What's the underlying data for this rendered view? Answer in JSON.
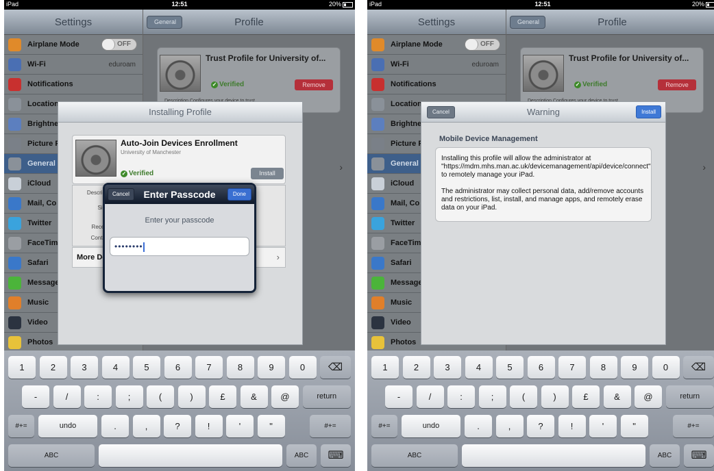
{
  "left": {
    "status": {
      "device": "iPad",
      "time": "12:51",
      "battery": "20%"
    },
    "sidebar": {
      "title": "Settings",
      "items": [
        {
          "label": "Airplane Mode",
          "icon": "airplane-icon",
          "color": "#e08a2a"
        },
        {
          "label": "Wi-Fi",
          "icon": "wifi-icon",
          "color": "#4a6fb3",
          "value": "eduroam"
        },
        {
          "label": "Notifications",
          "icon": "notifications-icon",
          "color": "#c8302f"
        },
        {
          "label": "Location",
          "icon": "location-icon",
          "color": "#8a9199"
        },
        {
          "label": "Brightne",
          "icon": "brightness-icon",
          "color": "#5c7fbf"
        },
        {
          "label": "Picture F",
          "icon": "picture-frame-icon",
          "color": "#7a8088"
        },
        {
          "label": "General",
          "icon": "gear-icon",
          "color": "#8a9199"
        },
        {
          "label": "iCloud",
          "icon": "cloud-icon",
          "color": "#c9d0d8"
        },
        {
          "label": "Mail, Co",
          "icon": "mail-icon",
          "color": "#3a78c9"
        },
        {
          "label": "Twitter",
          "icon": "twitter-icon",
          "color": "#3aa3dd"
        },
        {
          "label": "FaceTim",
          "icon": "facetime-icon",
          "color": "#9a9ea3"
        },
        {
          "label": "Safari",
          "icon": "safari-icon",
          "color": "#3a78c9"
        },
        {
          "label": "Message",
          "icon": "messages-icon",
          "color": "#4bb43a"
        },
        {
          "label": "Music",
          "icon": "music-icon",
          "color": "#e07f2a"
        },
        {
          "label": "Video",
          "icon": "video-icon",
          "color": "#2b3340"
        },
        {
          "label": "Photos",
          "icon": "photos-icon",
          "color": "#e8c23a"
        }
      ],
      "toggle_label": "OFF"
    },
    "detail": {
      "back_label": "General",
      "title": "Profile",
      "card_title": "Trust Profile for University of...",
      "verified": "Verified",
      "remove": "Remove",
      "desc": "Description   Configures your device to trust..."
    },
    "sheet": {
      "title": "Installing Profile",
      "profile_name": "Auto-Join Devices Enrollment",
      "org": "University of Manchester",
      "verified": "Verified",
      "install": "Install",
      "labels": [
        "Descrip",
        "Sig",
        "Recei",
        "Conta"
      ],
      "more": "More De"
    },
    "passcode": {
      "cancel": "Cancel",
      "title": "Enter Passcode",
      "done": "Done",
      "prompt": "Enter your passcode",
      "value": "••••••••"
    }
  },
  "right": {
    "status": {
      "device": "iPad",
      "time": "12:51",
      "battery": "20%"
    },
    "sidebar": {
      "title": "Settings",
      "items": [
        {
          "label": "Airplane Mode",
          "icon": "airplane-icon",
          "color": "#e08a2a"
        },
        {
          "label": "Wi-Fi",
          "icon": "wifi-icon",
          "color": "#4a6fb3",
          "value": "eduroam"
        },
        {
          "label": "Notifications",
          "icon": "notifications-icon",
          "color": "#c8302f"
        },
        {
          "label": "Location",
          "icon": "location-icon",
          "color": "#8a9199"
        },
        {
          "label": "Brightne",
          "icon": "brightness-icon",
          "color": "#5c7fbf"
        },
        {
          "label": "Picture F",
          "icon": "picture-frame-icon",
          "color": "#7a8088"
        },
        {
          "label": "General",
          "icon": "gear-icon",
          "color": "#8a9199"
        },
        {
          "label": "iCloud",
          "icon": "cloud-icon",
          "color": "#c9d0d8"
        },
        {
          "label": "Mail, Co",
          "icon": "mail-icon",
          "color": "#3a78c9"
        },
        {
          "label": "Twitter",
          "icon": "twitter-icon",
          "color": "#3aa3dd"
        },
        {
          "label": "FaceTim",
          "icon": "facetime-icon",
          "color": "#9a9ea3"
        },
        {
          "label": "Safari",
          "icon": "safari-icon",
          "color": "#3a78c9"
        },
        {
          "label": "Message",
          "icon": "messages-icon",
          "color": "#4bb43a"
        },
        {
          "label": "Music",
          "icon": "music-icon",
          "color": "#e07f2a"
        },
        {
          "label": "Video",
          "icon": "video-icon",
          "color": "#2b3340"
        },
        {
          "label": "Photos",
          "icon": "photos-icon",
          "color": "#e8c23a"
        }
      ],
      "toggle_label": "OFF"
    },
    "detail": {
      "back_label": "General",
      "title": "Profile",
      "card_title": "Trust Profile for University of...",
      "verified": "Verified",
      "remove": "Remove",
      "desc": "Description   Configures your device to trust..."
    },
    "warning": {
      "cancel": "Cancel",
      "title": "Warning",
      "install": "Install",
      "heading": "Mobile Device Management",
      "para1": "Installing this profile will allow the administrator at \"https://mdm.mhs.man.ac.uk/devicemanagement/api/device/connect\" to remotely manage your iPad.",
      "para2": "The administrator may collect personal data, add/remove accounts and restrictions, list, install, and manage apps, and remotely erase data on your iPad."
    }
  },
  "keyboard": {
    "row1": [
      "1",
      "2",
      "3",
      "4",
      "5",
      "6",
      "7",
      "8",
      "9",
      "0"
    ],
    "backspace_icon": "backspace-icon",
    "row2": [
      "-",
      "/",
      ":",
      ";",
      "(",
      ")",
      "£",
      "&",
      "@"
    ],
    "return_label": "return",
    "row3_left": "#+=",
    "undo": "undo",
    "row3": [
      ".",
      ",",
      "?",
      "!",
      "'",
      "\""
    ],
    "row3_right": "#+=",
    "abc": "ABC",
    "dismiss_icon": "keyboard-dismiss-icon"
  },
  "colors": {
    "accent_blue": "#3f79d6",
    "remove_red": "#b5303a",
    "verified_green": "#3e7b2c"
  }
}
